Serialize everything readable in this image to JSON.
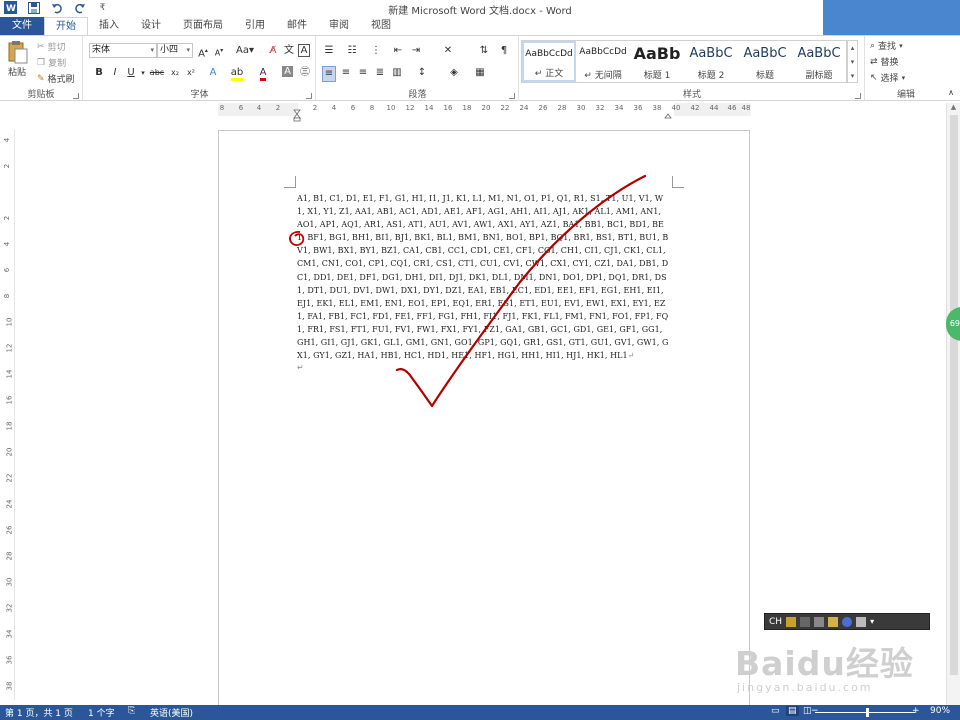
{
  "window": {
    "title": "新建 Microsoft Word 文档.docx - Word"
  },
  "qat": {
    "icons": [
      "word-app-icon",
      "save-icon",
      "undo-icon",
      "redo-icon",
      "customize-icon"
    ],
    "customize_glyph": "₹"
  },
  "tabs": [
    {
      "label": "文件"
    },
    {
      "label": "开始"
    },
    {
      "label": "插入"
    },
    {
      "label": "设计"
    },
    {
      "label": "页面布局"
    },
    {
      "label": "引用"
    },
    {
      "label": "邮件"
    },
    {
      "label": "审阅"
    },
    {
      "label": "视图"
    }
  ],
  "ribbon": {
    "clipboard": {
      "label": "剪贴板",
      "paste": "粘贴",
      "cut": "剪切",
      "copy": "复制",
      "format_painter": "格式刷"
    },
    "font": {
      "label": "字体",
      "font_name": "宋体",
      "font_size": "小四",
      "aa": "Aa"
    },
    "paragraph": {
      "label": "段落"
    },
    "styles": {
      "label": "样式",
      "items": [
        {
          "preview": "AaBbCcDd",
          "name": "↵ 正文"
        },
        {
          "preview": "AaBbCcDd",
          "name": "↵ 无间隔"
        },
        {
          "preview": "AaBb",
          "name": "标题 1"
        },
        {
          "preview": "AaBbC",
          "name": "标题 2"
        },
        {
          "preview": "AaBbC",
          "name": "标题"
        },
        {
          "preview": "AaBbC",
          "name": "副标题"
        }
      ]
    },
    "editing": {
      "label": "编辑",
      "find": "查找",
      "replace": "替换",
      "select": "选择"
    }
  },
  "ruler": {
    "h_ticks": [
      "8",
      "6",
      "4",
      "2",
      "2",
      "4",
      "6",
      "8",
      "10",
      "12",
      "14",
      "16",
      "18",
      "20",
      "22",
      "24",
      "26",
      "28",
      "30",
      "32",
      "34",
      "36",
      "38",
      "40",
      "42",
      "44",
      "46",
      "48"
    ],
    "v_ticks": [
      "4",
      "2",
      "2",
      "4",
      "6",
      "8",
      "10",
      "12",
      "14",
      "16",
      "18",
      "20",
      "22",
      "24",
      "26",
      "28",
      "30",
      "32",
      "34",
      "36",
      "38"
    ]
  },
  "document": {
    "text": "A1, B1, C1, D1, E1, F1, G1, H1, I1, J1, K1, L1, M1, N1, O1, P1, Q1, R1, S1, T1, U1, V1, W1, X1, Y1, Z1, AA1, AB1, AC1, AD1, AE1, AF1, AG1, AH1, AI1, AJ1, AK1, AL1, AM1, AN1, AO1, AP1, AQ1, AR1, AS1, AT1, AU1, AV1, AW1, AX1, AY1, AZ1, BA1, BB1, BC1, BD1, BE1, BF1, BG1, BH1, BI1, BJ1, BK1, BL1, BM1, BN1, BO1, BP1, BQ1, BR1, BS1, BT1, BU1, BV1, BW1, BX1, BY1, BZ1, CA1, CB1, CC1, CD1, CE1, CF1, CG1, CH1, CI1, CJ1, CK1, CL1, CM1, CN1, CO1, CP1, CQ1, CR1, CS1, CT1, CU1, CV1, CW1, CX1, CY1, CZ1, DA1, DB1, DC1, DD1, DE1, DF1, DG1, DH1, DI1, DJ1, DK1, DL1, DM1, DN1, DO1, DP1, DQ1, DR1, DS1, DT1, DU1, DV1, DW1, DX1, DY1, DZ1, EA1, EB1, EC1, ED1, EE1, EF1, EG1, EH1, EI1, EJ1, EK1, EL1, EM1, EN1, EO1, EP1, EQ1, ER1, ES1, ET1, EU1, EV1, EW1, EX1, EY1, EZ1, FA1, FB1, FC1, FD1, FE1, FF1, FG1, FH1, FI1, FJ1, FK1, FL1, FM1, FN1, FO1, FP1, FQ1, FR1, FS1, FT1, FU1, FV1, FW1, FX1, FY1, FZ1, GA1, GB1, GC1, GD1, GE1, GF1, GG1, GH1, GI1, GJ1, GK1, GL1, GM1, GN1, GO1, GP1, GQ1, GR1, GS1, GT1, GU1, GV1, GW1, GX1, GY1, GZ1, HA1, HB1, HC1, HD1, HE1, HF1, HG1, HH1, HI1, HJ1, HK1, HL1",
    "paragraph_mark": "↵",
    "end_mark": "↵"
  },
  "annotations": {
    "circle_color": "#c00000",
    "check_color": "#b00000"
  },
  "side_badge": "69",
  "ime_toolbar": {
    "label": "CH"
  },
  "watermark": {
    "brand": "Baidu经验",
    "url": "jingyan.baidu.com"
  },
  "statusbar": {
    "page": "第 1 页，共 1 页",
    "words": "1 个字",
    "language": "英语(美国)",
    "zoom_minus": "−",
    "zoom_plus": "+",
    "zoom": "90%"
  },
  "colors": {
    "accent": "#2b579a",
    "top_right_box": "#4a86cf",
    "badge_green": "#4aba6a"
  }
}
